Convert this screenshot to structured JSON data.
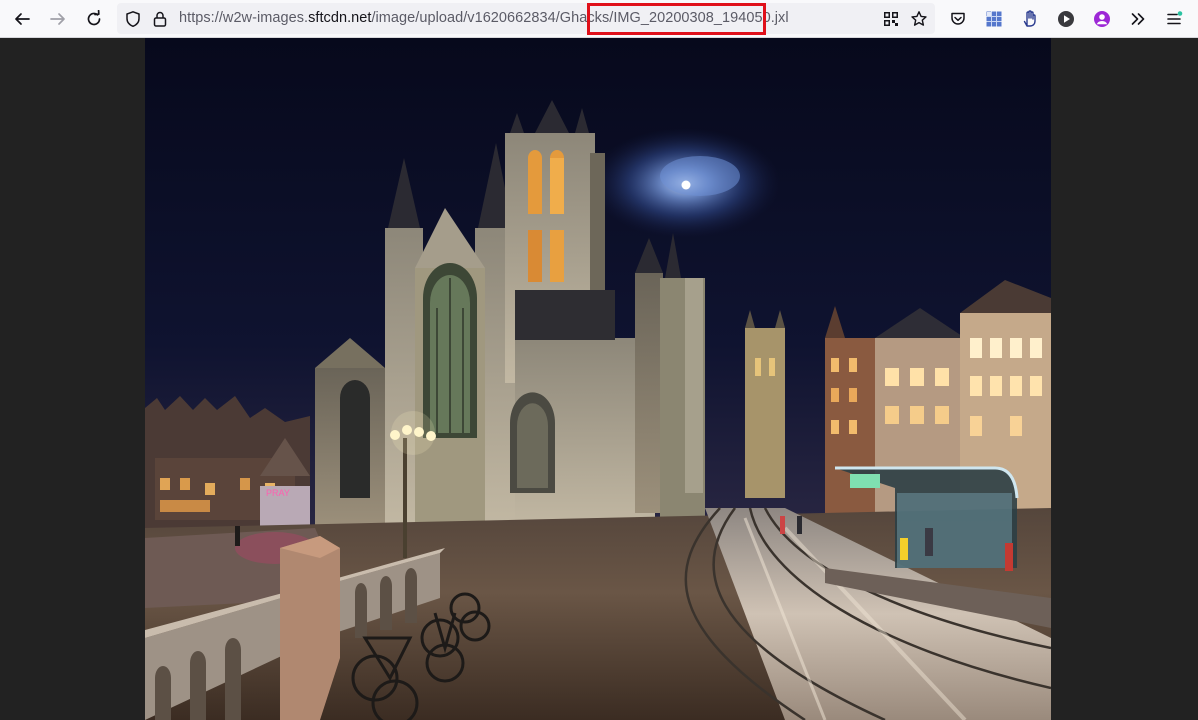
{
  "browser": {
    "url": {
      "prefix": "https://w2w-images.",
      "domain": "sftcdn.net",
      "path": "/image/upload/v1620662834/Ghacks/IMG_20200308_194050.jxl",
      "highlighted_part": "IMG_20200308_194050.jxl"
    },
    "icons": {
      "back": "back-arrow-icon",
      "forward": "forward-arrow-icon",
      "reload": "reload-icon",
      "tracking": "shield-icon",
      "lock": "lock-icon",
      "qr": "qr-code-icon",
      "bookmark": "star-icon",
      "pocket": "pocket-icon",
      "extension1": "grid-extension-icon",
      "extension2": "hand-extension-icon",
      "extension3": "play-icon",
      "account": "account-icon",
      "overflow": "chevrons-right-icon",
      "menu": "hamburger-menu-icon"
    }
  },
  "colors": {
    "toolbar_bg": "#f9f9fb",
    "urlbar_bg": "#f0f0f4",
    "highlight": "#e0101a",
    "viewer_bg": "#222222",
    "accent_purple": "#9d28d6",
    "menu_dot": "#2ac3a2"
  }
}
